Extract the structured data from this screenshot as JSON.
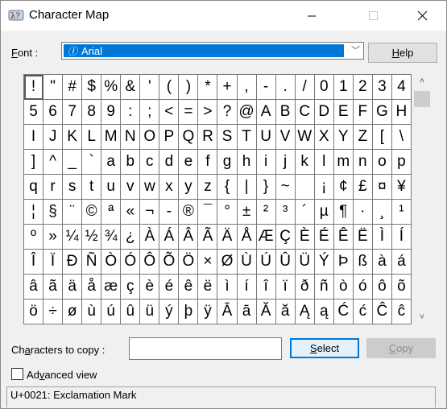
{
  "window": {
    "title": "Character Map",
    "app_icon": "character-map-icon",
    "controls": {
      "minimize": "—",
      "maximize": "☐",
      "close": "✕"
    }
  },
  "font": {
    "label_prefix": "",
    "label_accel": "F",
    "label_rest": "ont :",
    "selected": "Arial",
    "font_type_icon": "opentype-font-icon"
  },
  "buttons": {
    "help_accel": "H",
    "help_rest": "elp",
    "select_accel": "S",
    "select_rest": "elect",
    "copy_accel": "C",
    "copy_rest": "opy"
  },
  "grid": {
    "selected_index": 0,
    "characters": [
      "!",
      "\"",
      "#",
      "$",
      "%",
      "&",
      "'",
      "(",
      ")",
      "*",
      "+",
      ",",
      "-",
      ".",
      "/",
      "0",
      "1",
      "2",
      "3",
      "4",
      "5",
      "6",
      "7",
      "8",
      "9",
      ":",
      ";",
      "<",
      "=",
      ">",
      "?",
      "@",
      "A",
      "B",
      "C",
      "D",
      "E",
      "F",
      "G",
      "H",
      "I",
      "J",
      "K",
      "L",
      "M",
      "N",
      "O",
      "P",
      "Q",
      "R",
      "S",
      "T",
      "U",
      "V",
      "W",
      "X",
      "Y",
      "Z",
      "[",
      "\\",
      "]",
      "^",
      "_",
      "`",
      "a",
      "b",
      "c",
      "d",
      "e",
      "f",
      "g",
      "h",
      "i",
      "j",
      "k",
      "l",
      "m",
      "n",
      "o",
      "p",
      "q",
      "r",
      "s",
      "t",
      "u",
      "v",
      "w",
      "x",
      "y",
      "z",
      "{",
      "|",
      "}",
      "~",
      "",
      "¡",
      "¢",
      "£",
      "¤",
      "¥",
      "¦",
      "§",
      "¨",
      "©",
      "ª",
      "«",
      "¬",
      "-",
      "®",
      "¯",
      "°",
      "±",
      "²",
      "³",
      "´",
      "µ",
      "¶",
      "·",
      "¸",
      "¹",
      "º",
      "»",
      "¼",
      "½",
      "¾",
      "¿",
      "À",
      "Á",
      "Â",
      "Ã",
      "Ä",
      "Å",
      "Æ",
      "Ç",
      "È",
      "É",
      "Ê",
      "Ë",
      "Ì",
      "Í",
      "Î",
      "Ï",
      "Ð",
      "Ñ",
      "Ò",
      "Ó",
      "Ô",
      "Õ",
      "Ö",
      "×",
      "Ø",
      "Ù",
      "Ú",
      "Û",
      "Ü",
      "Ý",
      "Þ",
      "ß",
      "à",
      "á",
      "â",
      "ã",
      "ä",
      "å",
      "æ",
      "ç",
      "è",
      "é",
      "ê",
      "ë",
      "ì",
      "í",
      "î",
      "ï",
      "ð",
      "ñ",
      "ò",
      "ó",
      "ô",
      "õ",
      "ö",
      "÷",
      "ø",
      "ù",
      "ú",
      "û",
      "ü",
      "ý",
      "þ",
      "ÿ",
      "Ā",
      "ā",
      "Ă",
      "ă",
      "Ą",
      "ą",
      "Ć",
      "ć",
      "Ĉ",
      "ĉ"
    ]
  },
  "scrollbar": {
    "up": "˄",
    "down": "˅"
  },
  "copy": {
    "label_pre": "Ch",
    "label_accel": "a",
    "label_rest": "racters to copy :",
    "value": ""
  },
  "advanced": {
    "label_pre": "Ad",
    "label_accel": "v",
    "label_rest": "anced view",
    "checked": false
  },
  "status": {
    "text": "U+0021: Exclamation Mark"
  }
}
